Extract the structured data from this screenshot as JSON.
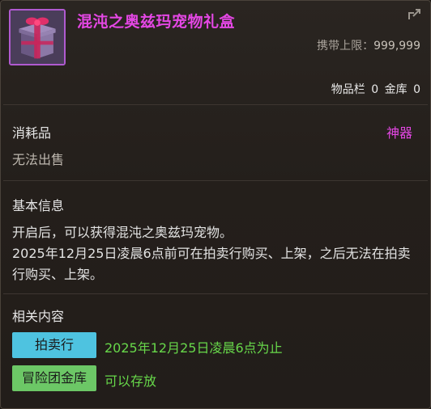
{
  "item": {
    "title": "混沌之奥兹玛宠物礼盒",
    "icon": "gift-box-icon",
    "carry_limit_label": "携带上限：",
    "carry_limit_value": "999,999",
    "inventory_label": "物品栏",
    "inventory_count": "0",
    "warehouse_label": "金库",
    "warehouse_count": "0"
  },
  "category": {
    "type": "消耗品",
    "rarity": "神器",
    "sell_note": "无法出售"
  },
  "basic_info": {
    "heading": "基本信息",
    "line1": "开启后，可以获得混沌之奥兹玛宠物。",
    "line2": "2025年12月25日凌晨6点前可在拍卖行购买、上架，之后无法在拍卖行购买、上架。"
  },
  "related": {
    "heading": "相关内容",
    "auction_label": "拍卖行",
    "auction_note": "2025年12月25日凌晨6点为止",
    "guild_label": "冒险团金库",
    "guild_note": "可以存放"
  },
  "colors": {
    "title": "#e447e4",
    "rarity": "#e447e4",
    "auction_tag": "#4ec3e0",
    "guild_tag": "#6cc766",
    "note_green": "#67d84a"
  }
}
